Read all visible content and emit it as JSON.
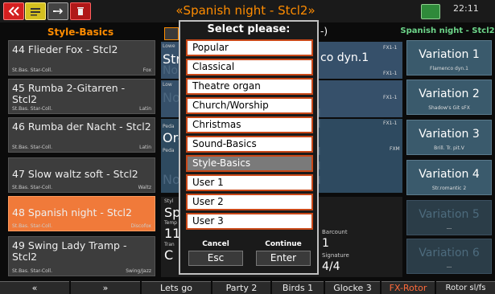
{
  "window_title": "«Spanish night - Stcl2»",
  "clock": "22:11",
  "colors": {
    "accent_orange": "#ff8c00",
    "selected_item": "#f07a3a",
    "variation_green": "#6dd68a",
    "dialog_border": "#c94818"
  },
  "left_panel": {
    "header": "Style-Basics",
    "items": [
      {
        "name": "44 Flieder Fox - Stcl2",
        "collection": "St.Bas. Star-Coll.",
        "genre": "Fox",
        "selected": false
      },
      {
        "name": "45 Rumba 2-Gitarren - Stcl2",
        "collection": "St.Bas. Star-Coll.",
        "genre": "Latin",
        "selected": false
      },
      {
        "name": "46 Rumba der Nacht - Stcl2",
        "collection": "St.Bas. Star-Coll.",
        "genre": "Latin",
        "selected": false
      },
      {
        "name": "47 Slow waltz soft - Stcl2",
        "collection": "St.Bas. Star-Coll.",
        "genre": "Waltz",
        "selected": false
      },
      {
        "name": "48 Spanish night - Stcl2",
        "collection": "St.Bas. Star-Coll.",
        "genre": "Discofox",
        "selected": true
      },
      {
        "name": "49 Swing Lady Tramp - Stcl2",
        "collection": "St.Bas. Star-Coll.",
        "genre": "Swing/Jazz",
        "selected": false
      }
    ]
  },
  "middle": {
    "lower1_label": "Lowe",
    "lower1_value": "Str",
    "lower1_right": "co dyn.1",
    "lower2_label": "Low",
    "pedal1_label": "Peda",
    "pedal1_value": "Org",
    "pedal2_label": "Peda",
    "style_label": "Styl",
    "style_value": "Sp",
    "tempo_label": "Temp",
    "tempo_value": "11",
    "trans_label": "Tran",
    "trans_value": "C",
    "barcount_label": "Barcount",
    "barcount_value": "1",
    "signature_label": "Signature",
    "signature_value": "4/4",
    "fx_labels": [
      "FX1-1",
      "FX1-1",
      "FX1-1",
      "FX1-1",
      "FXM"
    ],
    "header_suffix": "-)",
    "part_fragment": "nd",
    "no_fragment": "No"
  },
  "right_panel": {
    "header": "Spanish night - Stcl2",
    "variations": [
      {
        "name": "Variation 1",
        "sub": "Flamenco dyn.1",
        "active": true
      },
      {
        "name": "Variation 2",
        "sub": "Shadow's Git sFX",
        "active": true
      },
      {
        "name": "Variation 3",
        "sub": "Brill. Tr. pit.V",
        "active": true
      },
      {
        "name": "Variation 4",
        "sub": "Str.romantic 2",
        "active": true
      },
      {
        "name": "Variation 5",
        "sub": "---",
        "active": false
      },
      {
        "name": "Variation 6",
        "sub": "---",
        "active": false
      }
    ]
  },
  "bottom_bar": {
    "up_label": "«",
    "down_label": "»",
    "buttons": [
      "Lets go",
      "Party 2",
      "Birds 1",
      "Glocke 3",
      "FX-Rotor",
      "Rotor sl/fs"
    ]
  },
  "dialog": {
    "title": "Select please:",
    "options": [
      "Popular",
      "Classical",
      "Theatre organ",
      "Church/Worship",
      "Christmas",
      "Sound-Basics",
      "Style-Basics",
      "User 1",
      "User 2",
      "User 3"
    ],
    "selected_index": 6,
    "cancel_label": "Cancel",
    "cancel_button": "Esc",
    "continue_label": "Continue",
    "continue_button": "Enter"
  },
  "icons": [
    "back-icon",
    "menu-icon",
    "usb-icon",
    "trash-icon",
    "organ-icon"
  ]
}
